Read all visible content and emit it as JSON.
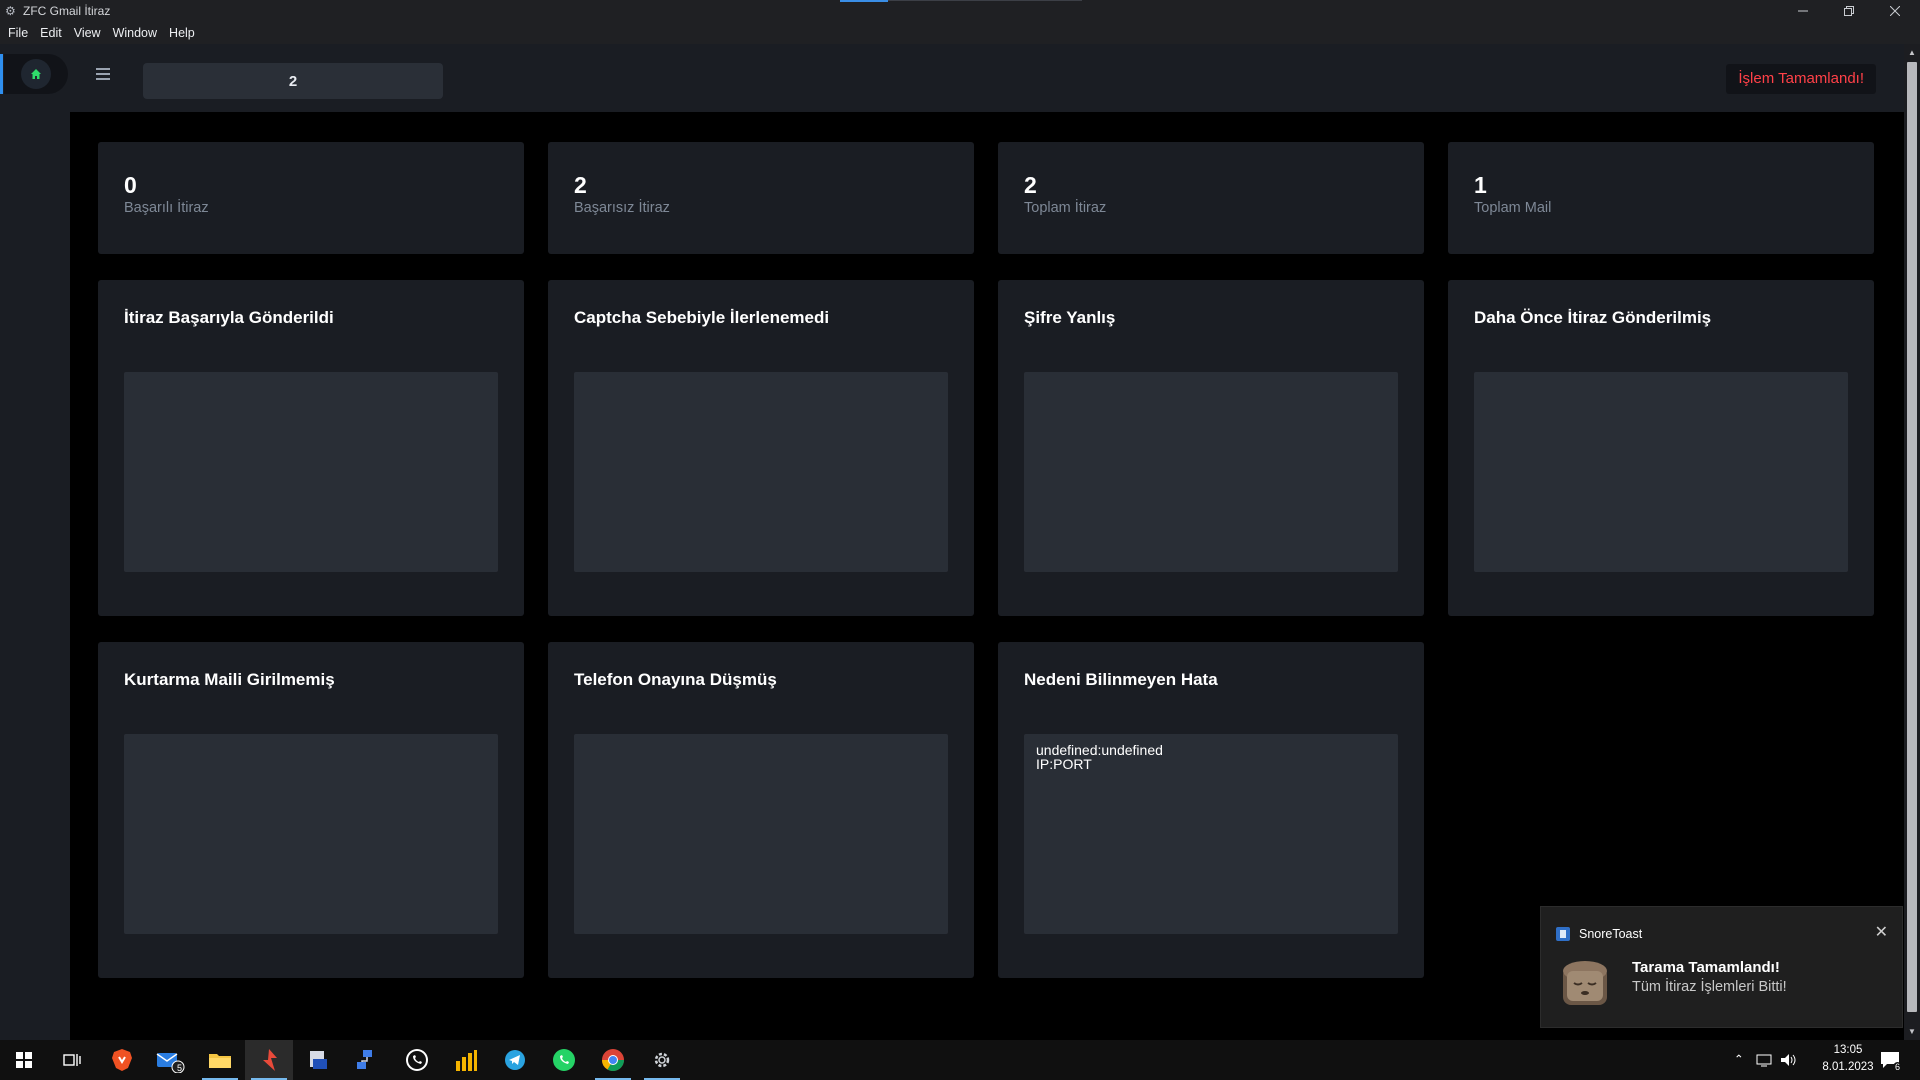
{
  "window": {
    "title": "ZFC Gmail İtiraz"
  },
  "menu": [
    "File",
    "Edit",
    "View",
    "Window",
    "Help"
  ],
  "topbar": {
    "count_value": "2",
    "status": "İşlem Tamamlandı!"
  },
  "stats": [
    {
      "value": "0",
      "label": "Başarılı İtiraz"
    },
    {
      "value": "2",
      "label": "Başarısız İtiraz"
    },
    {
      "value": "2",
      "label": "Toplam İtiraz"
    },
    {
      "value": "1",
      "label": "Toplam Mail"
    }
  ],
  "panels": [
    {
      "title": "İtiraz Başarıyla Gönderildi",
      "content": ""
    },
    {
      "title": "Captcha Sebebiyle İlerlenemedi",
      "content": ""
    },
    {
      "title": "Şifre Yanlış",
      "content": ""
    },
    {
      "title": "Daha Önce İtiraz Gönderilmiş",
      "content": ""
    },
    {
      "title": "Kurtarma Maili Girilmemiş",
      "content": ""
    },
    {
      "title": "Telefon Onayına Düşmüş",
      "content": ""
    },
    {
      "title": "Nedeni Bilinmeyen Hata",
      "content": "undefined:undefined\nIP:PORT"
    }
  ],
  "toast": {
    "app": "SnoreToast",
    "title": "Tarama Tamamlandı!",
    "body": "Tüm İtiraz İşlemleri Bitti!"
  },
  "taskbar": {
    "mail_badge": "5",
    "time": "13:05",
    "date": "8.01.2023",
    "notification_count": "6"
  },
  "colors": {
    "accent": "#2f8fef",
    "status_red": "#ff4148",
    "card_bg": "#1a1d23",
    "box_bg": "#292e36"
  }
}
